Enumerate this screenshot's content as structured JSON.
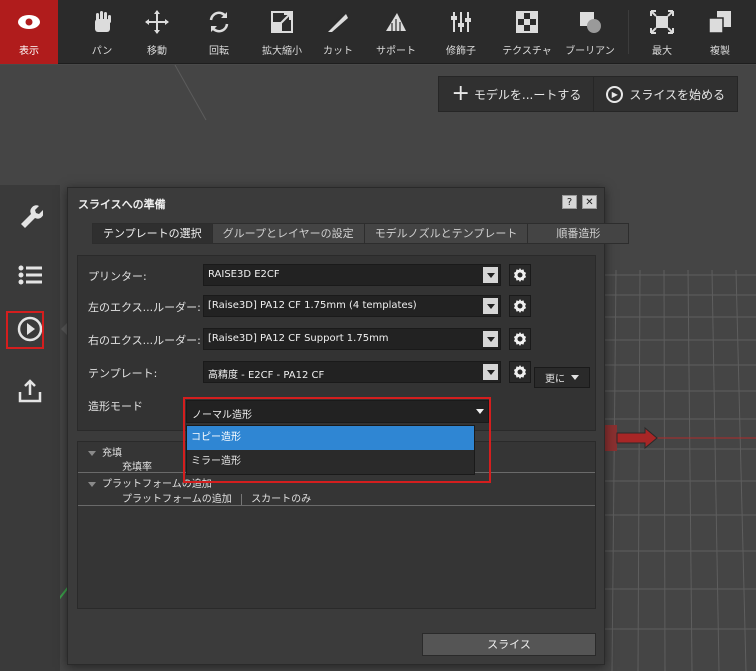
{
  "toolbar": {
    "tools": [
      {
        "label": "表示",
        "icon": "eye-icon"
      },
      {
        "label": "パン",
        "icon": "hand-icon"
      },
      {
        "label": "移動",
        "icon": "move-icon"
      },
      {
        "label": "回転",
        "icon": "rotate-icon"
      },
      {
        "label": "拡大縮小",
        "icon": "scale-icon"
      },
      {
        "label": "カット",
        "icon": "cut-icon"
      },
      {
        "label": "サポート",
        "icon": "support-icon"
      },
      {
        "label": "修飾子",
        "icon": "modifier-icon"
      },
      {
        "label": "テクスチャ",
        "icon": "texture-icon"
      },
      {
        "label": "ブーリアン",
        "icon": "boolean-icon"
      },
      {
        "label": "最大",
        "icon": "maximize-icon"
      },
      {
        "label": "複製",
        "icon": "duplicate-icon"
      }
    ],
    "active_color": "#b01c1c"
  },
  "viewport": {
    "add_model_label": "モデルを...ートする",
    "start_slice_label": "スライスを始める"
  },
  "sidebar": {
    "icons": [
      "wrench-icon",
      "list-icon",
      "play-circle-icon",
      "export-icon"
    ],
    "highlight_color": "#d41e1e"
  },
  "dialog": {
    "title": "スライスへの準備",
    "help_label": "?",
    "close_label": "✕",
    "tabs": [
      "テンプレートの選択",
      "グループとレイヤーの設定",
      "モデルノズルとテンプレート",
      "順番造形"
    ],
    "printer_label": "プリンター:",
    "printer_value": "RAISE3D E2CF",
    "left_extruder_label": "左のエクス...ルーダー:",
    "left_extruder_value": "[Raise3D] PA12 CF 1.75mm (4 templates)",
    "right_extruder_label": "右のエクス...ルーダー:",
    "right_extruder_value": "[Raise3D] PA12 CF Support 1.75mm",
    "template_label": "テンプレート:",
    "template_value": "高精度 - E2CF - PA12 CF",
    "more_label": "更に",
    "mode_label": "造形モード",
    "mode_value": "ノーマル造形",
    "mode_options": [
      "コピー造形",
      "ミラー造形"
    ],
    "tree": {
      "fill": "充填",
      "fill_rate": "充填率",
      "platform_add": "プラットフォームの追加",
      "platform_add_item": "プラットフォームの追加",
      "skirt_only": "スカートのみ"
    },
    "slice_label": "スライス",
    "selection_color": "#2f86d3"
  }
}
